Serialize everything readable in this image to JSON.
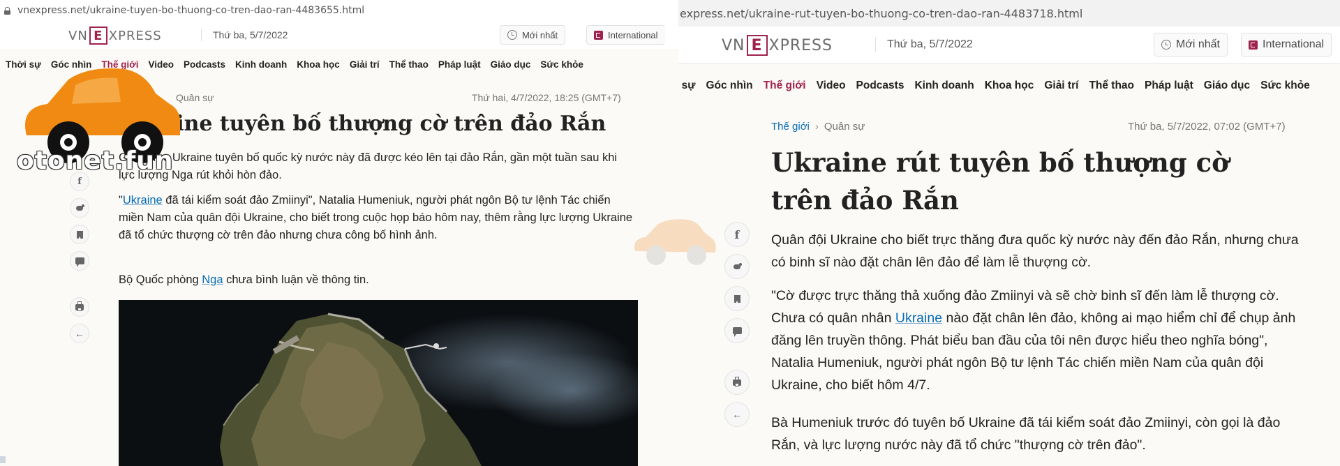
{
  "left": {
    "url": "vnexpress.net/ukraine-tuyen-bo-thuong-co-tren-dao-ran-4483655.html",
    "header": {
      "logo_left": "VN",
      "logo_e": "E",
      "logo_right": "XPRESS",
      "date": "Thứ ba, 5/7/2022",
      "latest_label": "Mới nhất",
      "intl_label": "International"
    },
    "nav": [
      "Thời sự",
      "Góc nhìn",
      "Thế giới",
      "Video",
      "Podcasts",
      "Kinh doanh",
      "Khoa học",
      "Giải trí",
      "Thể thao",
      "Pháp luật",
      "Giáo dục",
      "Sức khỏe"
    ],
    "breadcrumb_section": "Quân sự",
    "pubdate": "Thứ hai, 4/7/2022, 18:25 (GMT+7)",
    "title": "Ukraine tuyên bố thượng cờ trên đảo Rắn",
    "p1": "Giới chức Ukraine tuyên bố quốc kỳ nước này đã được kéo lên tại đảo Rắn, gần một tuần sau khi lực lượng Nga rút khỏi hòn đảo.",
    "p2_open": "\"",
    "p2_link": "Ukraine",
    "p2_rest": " đã tái kiểm soát đảo Zmiinyi\", Natalia Humeniuk, người phát ngôn Bộ tư lệnh Tác chiến miền Nam của quân đội Ukraine, cho biết trong cuộc họp báo hôm nay, thêm rằng lực lượng Ukraine đã tổ chức thượng cờ trên đảo nhưng chưa công bố hình ảnh.",
    "p3_a": "Bộ Quốc phòng ",
    "p3_link": "Nga",
    "p3_b": " chưa bình luận về thông tin."
  },
  "right": {
    "url": "express.net/ukraine-rut-tuyen-bo-thuong-co-tren-dao-ran-4483718.html",
    "header": {
      "logo_left": "VN",
      "logo_e": "E",
      "logo_right": "XPRESS",
      "date": "Thứ ba, 5/7/2022",
      "latest_label": "Mới nhất",
      "intl_label": "International"
    },
    "nav": [
      "i sự",
      "Góc nhìn",
      "Thế giới",
      "Video",
      "Podcasts",
      "Kinh doanh",
      "Khoa học",
      "Giải trí",
      "Thể thao",
      "Pháp luật",
      "Giáo dục",
      "Sức khỏe"
    ],
    "breadcrumb_category": "Thế giới",
    "breadcrumb_section": "Quân sự",
    "pubdate": "Thứ ba, 5/7/2022, 07:02 (GMT+7)",
    "title": "Ukraine rút tuyên bố thượng cờ trên đảo Rắn",
    "p1": "Quân đội Ukraine cho biết trực thăng đưa quốc kỳ nước này đến đảo Rắn, nhưng chưa có binh sĩ nào đặt chân lên đảo để làm lễ thượng cờ.",
    "p2_a": "\"Cờ được trực thăng thả xuống đảo Zmiinyi và sẽ chờ binh sĩ đến làm lễ thượng cờ. Chưa có quân nhân ",
    "p2_link": "Ukraine",
    "p2_b": " nào đặt chân lên đảo, không ai mạo hiểm chỉ để chụp ảnh đăng lên truyền thông. Phát biểu ban đầu của tôi nên được hiểu theo nghĩa bóng\", Natalia Humeniuk, người phát ngôn Bộ tư lệnh Tác chiến miền Nam của quân đội Ukraine, cho biết hôm 4/7.",
    "p3": "Bà Humeniuk trước đó tuyên bố Ukraine đã tái kiểm soát đảo Zmiinyi, còn gọi là đảo Rắn, và lực lượng nước này đã tổ chức \"thượng cờ trên đảo\"."
  },
  "watermark": {
    "text": "otonet.fun",
    "faint_text": "otonet.fun"
  },
  "colors": {
    "brand": "#9f224e",
    "link": "#076db6",
    "watermark_car": "#f08a12"
  }
}
